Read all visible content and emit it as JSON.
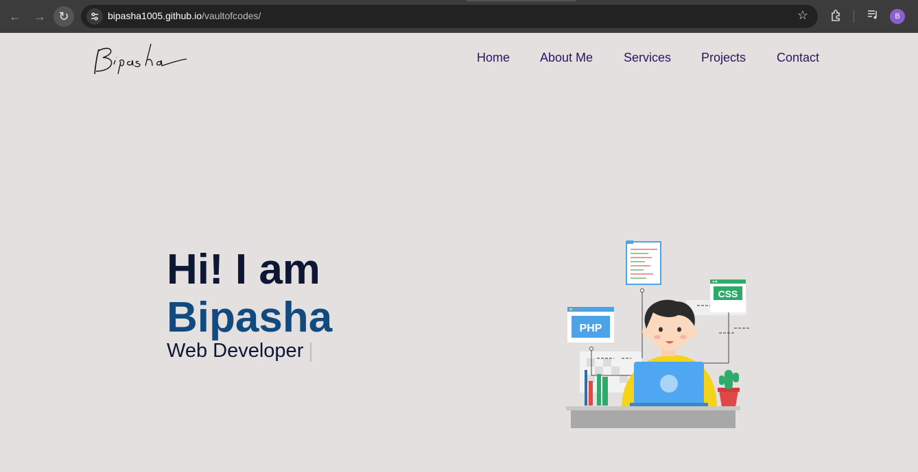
{
  "browser": {
    "url_domain": "bipasha1005.github.io",
    "url_path": "/vaultofcodes/",
    "profile_initial": "B",
    "icons": [
      "back-arrow-icon",
      "forward-arrow-icon",
      "reload-icon",
      "site-settings-icon",
      "bookmark-star-icon",
      "extensions-icon",
      "media-controls-icon"
    ]
  },
  "site": {
    "logo_text": "Bipasha",
    "nav": [
      "Home",
      "About Me",
      "Services",
      "Projects",
      "Contact"
    ]
  },
  "hero": {
    "greeting": "Hi! I am",
    "name": "Bipasha",
    "role": "Web Developer"
  },
  "illustration": {
    "php_label": "PHP",
    "css_label": "CSS"
  },
  "colors": {
    "page_bg": "#e4e0e0",
    "nav_link": "#2a1463",
    "heading_dark": "#0d1733",
    "name_blue": "#104a7e",
    "chrome_bg": "#3c3c3c"
  }
}
